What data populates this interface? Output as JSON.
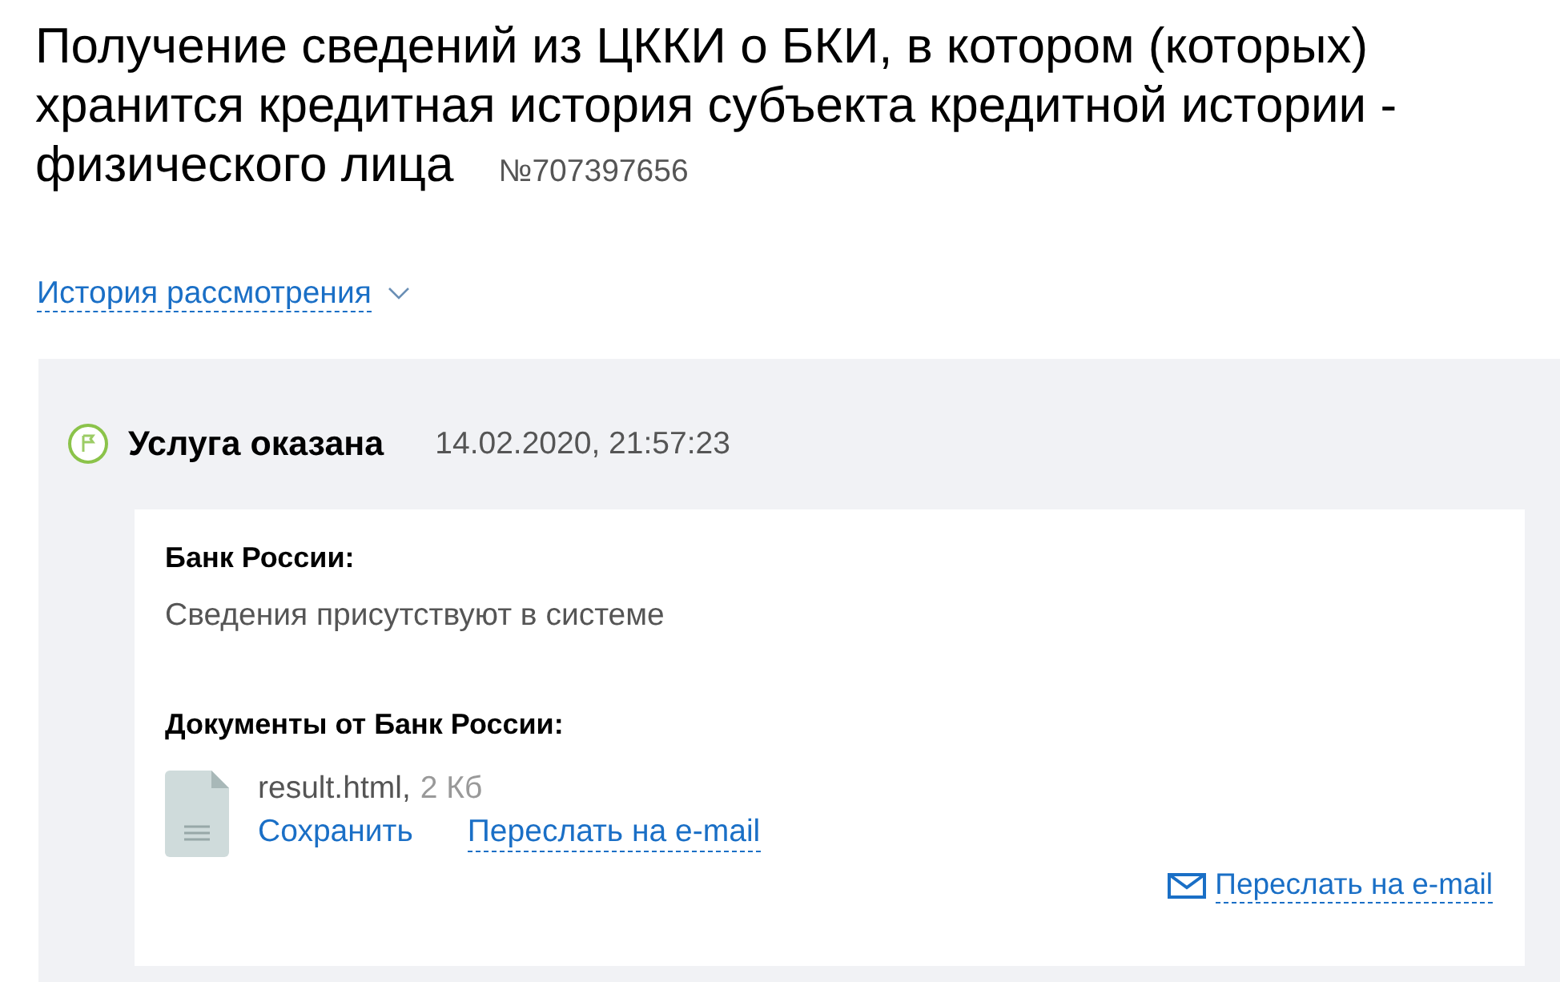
{
  "title_lines": [
    "Получение сведений из ЦККИ о БКИ, в котором (которых)",
    "хранится кредитная история субъекта кредитной истории -",
    "физического лица"
  ],
  "order_number": "№707397656",
  "history_link": {
    "label": "История рассмотрения",
    "expanded": false
  },
  "status": {
    "label": "Услуга оказана",
    "datetime": "14.02.2020, 21:57:23"
  },
  "result": {
    "sender_label": "Банк России:",
    "message": "Сведения присутствуют в системе",
    "documents_label": "Документы от Банк России:",
    "files": [
      {
        "name": "result.html,",
        "size": "2 Кб",
        "actions": [
          {
            "kind": "plain",
            "label": "Сохранить"
          },
          {
            "kind": "dashed",
            "label": "Переслать на e-mail"
          }
        ]
      }
    ],
    "forward_link": "Переслать на e-mail"
  }
}
